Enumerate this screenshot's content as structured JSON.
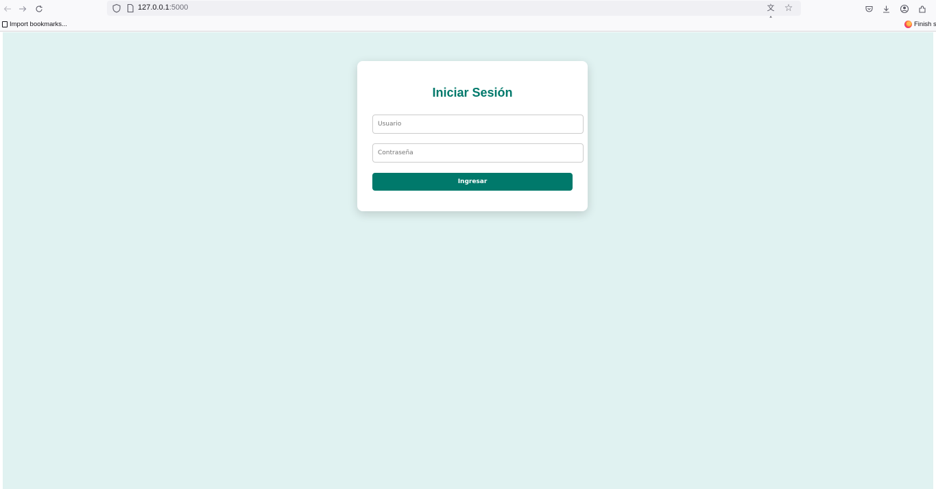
{
  "browser": {
    "url_host": "127.0.0.1",
    "url_port": ":5000",
    "bookmarks": {
      "import_label": "Import bookmarks...",
      "finish_label": "Finish se"
    }
  },
  "login": {
    "title": "Iniciar Sesión",
    "username_placeholder": "Usuario",
    "password_placeholder": "Contraseña",
    "submit_label": "Ingresar"
  },
  "colors": {
    "page_background": "#e0f2f1",
    "accent": "#00796b",
    "card_background": "#ffffff"
  },
  "icons": {
    "back": "arrow-left-icon",
    "forward": "arrow-right-icon",
    "reload": "reload-icon",
    "tracking": "shield-icon",
    "page": "page-icon",
    "translate": "translate-icon",
    "bookmark": "star-icon",
    "pocket": "pocket-icon",
    "downloads": "download-icon",
    "account": "account-icon",
    "extensions": "extensions-icon"
  }
}
